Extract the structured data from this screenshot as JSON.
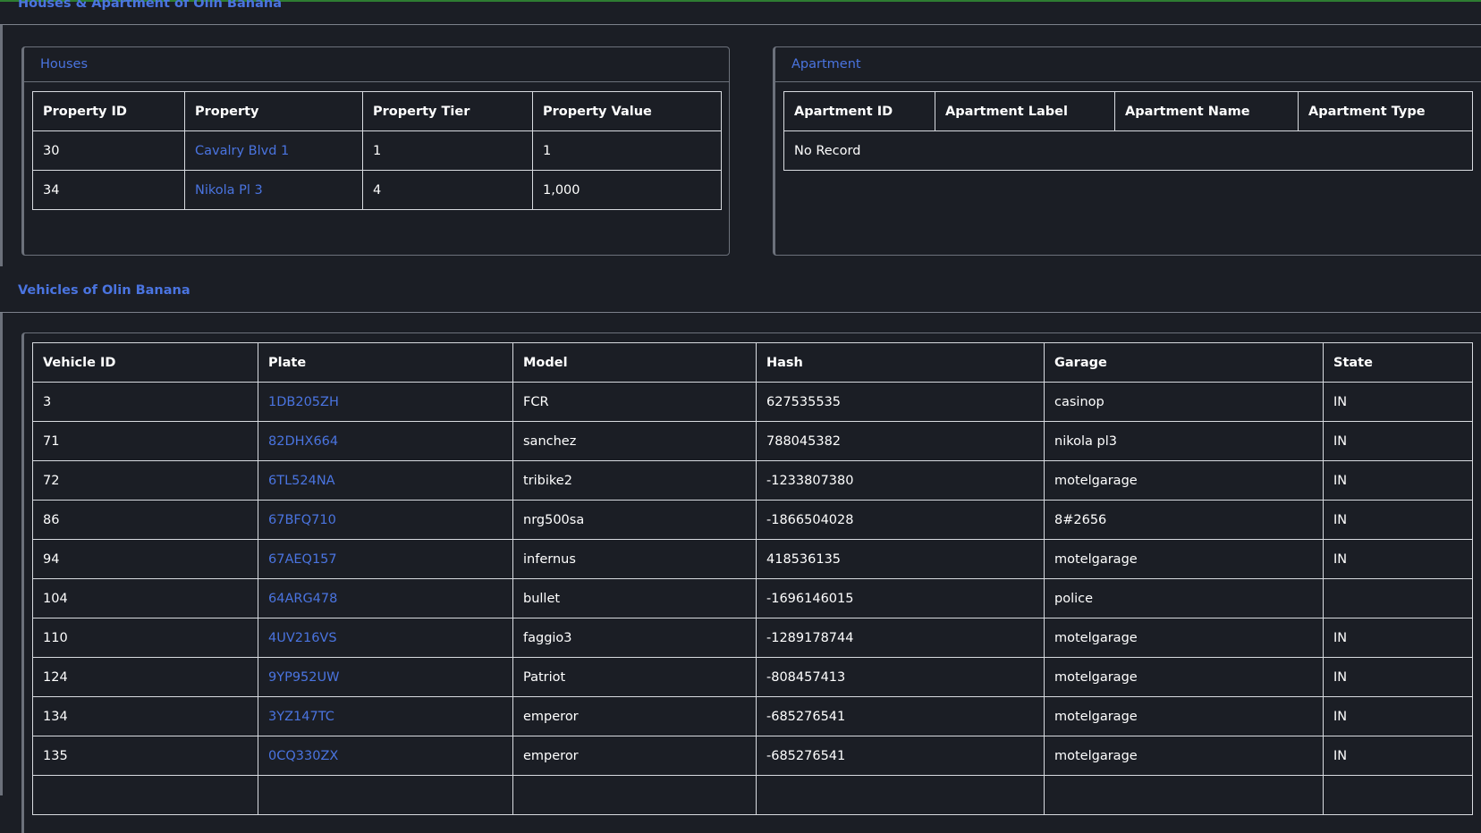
{
  "houses_section": {
    "title": "Houses & Apartment of Olin Banana"
  },
  "houses": {
    "title": "Houses",
    "columns": [
      "Property ID",
      "Property",
      "Property Tier",
      "Property Value"
    ],
    "rows": [
      [
        "30",
        "Cavalry Blvd 1",
        "1",
        "1"
      ],
      [
        "34",
        "Nikola Pl 3",
        "4",
        "1,000"
      ]
    ]
  },
  "apartment": {
    "title": "Apartment",
    "columns": [
      "Apartment ID",
      "Apartment Label",
      "Apartment Name",
      "Apartment Type"
    ],
    "empty_text": "No Record"
  },
  "vehicles_section": {
    "title": "Vehicles of Olin Banana"
  },
  "vehicles": {
    "columns": [
      "Vehicle ID",
      "Plate",
      "Model",
      "Hash",
      "Garage",
      "State"
    ],
    "rows": [
      [
        "3",
        "1DB205ZH",
        "FCR",
        "627535535",
        "casinop",
        "IN"
      ],
      [
        "71",
        "82DHX664",
        "sanchez",
        "788045382",
        "nikola pl3",
        "IN"
      ],
      [
        "72",
        "6TL524NA",
        "tribike2",
        "-1233807380",
        "motelgarage",
        "IN"
      ],
      [
        "86",
        "67BFQ710",
        "nrg500sa",
        "-1866504028",
        "8#2656",
        "IN"
      ],
      [
        "94",
        "67AEQ157",
        "infernus",
        "418536135",
        "motelgarage",
        "IN"
      ],
      [
        "104",
        "64ARG478",
        "bullet",
        "-1696146015",
        "police",
        ""
      ],
      [
        "110",
        "4UV216VS",
        "faggio3",
        "-1289178744",
        "motelgarage",
        "IN"
      ],
      [
        "124",
        "9YP952UW",
        "Patriot",
        "-808457413",
        "motelgarage",
        "IN"
      ],
      [
        "134",
        "3YZ147TC",
        "emperor",
        "-685276541",
        "motelgarage",
        "IN"
      ],
      [
        "135",
        "0CQ330ZX",
        "emperor",
        "-685276541",
        "motelgarage",
        "IN"
      ],
      [
        "",
        "",
        "",
        "",
        "",
        ""
      ]
    ]
  },
  "colors": {
    "accent": "#4a74e0",
    "background": "#1b1e25",
    "border": "#d8dbe0",
    "top_bar": "#2e7d32"
  }
}
